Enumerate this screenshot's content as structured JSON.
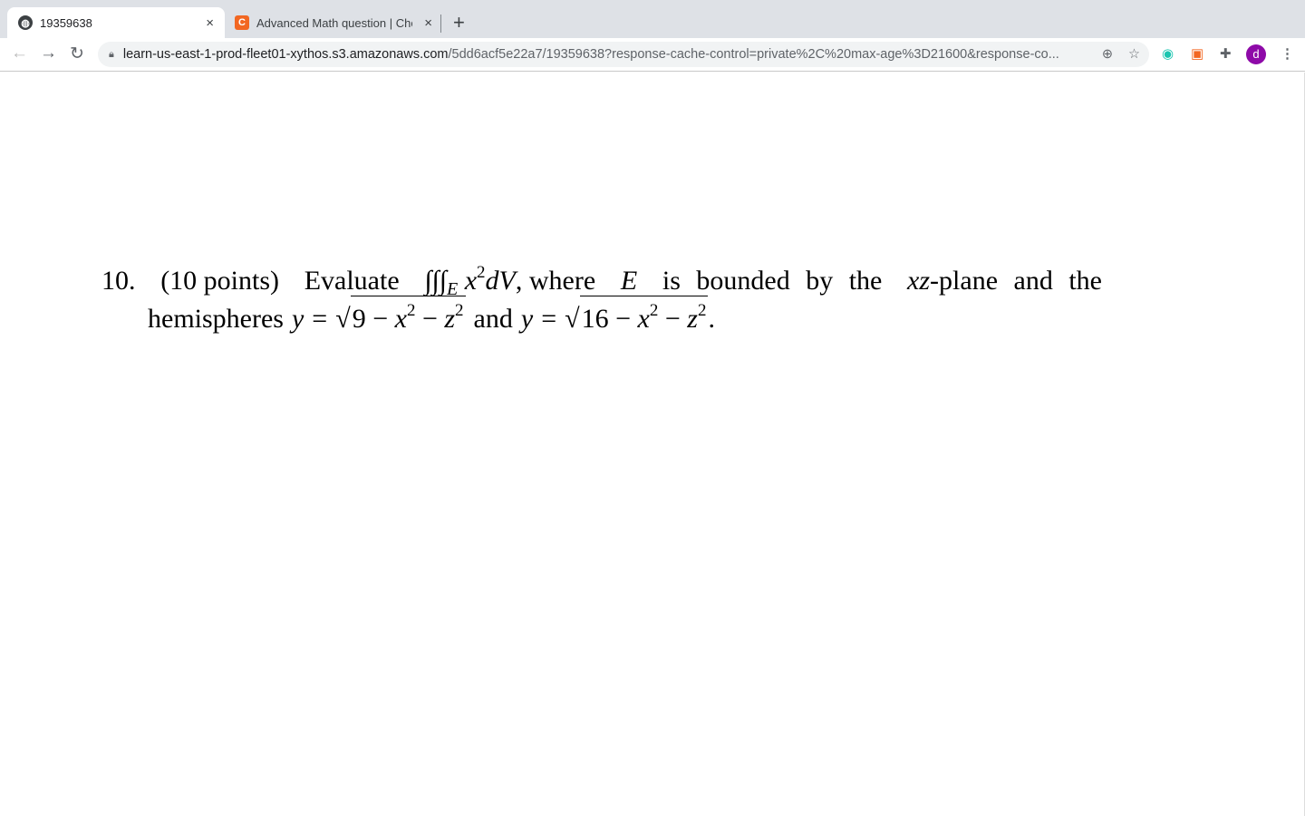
{
  "browser": {
    "tabs": [
      {
        "title": "19359638",
        "icon": "globe-icon",
        "active": true
      },
      {
        "title": "Advanced Math question | Chegg",
        "icon": "chegg-icon",
        "favicon_letter": "C",
        "active": false
      }
    ],
    "new_tab_label": "+",
    "close_label": "×",
    "url_host": "learn-us-east-1-prod-fleet01-xythos.s3.amazonaws.com",
    "url_path": "/5dd6acf5e22a7/19359638?response-cache-control=private%2C%20max-age%3D21600&response-co...",
    "profile_initial": "d",
    "colors": {
      "chegg": "#f26722",
      "profile": "#8e0aa8"
    }
  },
  "problem": {
    "number": "10.",
    "points": "(10 points)",
    "evaluate": "Evaluate",
    "integral": "∫∫∫",
    "integral_sub": "E",
    "integrand_var": "x",
    "integrand_exp": "2",
    "differential": "dV",
    "where": ", where",
    "region": "E",
    "bounded": "is bounded by the",
    "plane_vars": "xz",
    "plane_rest": "-plane and the",
    "hemispheres": "hemispheres",
    "y": "y",
    "eq": "=",
    "radical": "√",
    "r1_const": "9",
    "minus": "−",
    "x": "x",
    "z": "z",
    "exp2": "2",
    "and": "and",
    "r2_const": "16",
    "period": "."
  }
}
